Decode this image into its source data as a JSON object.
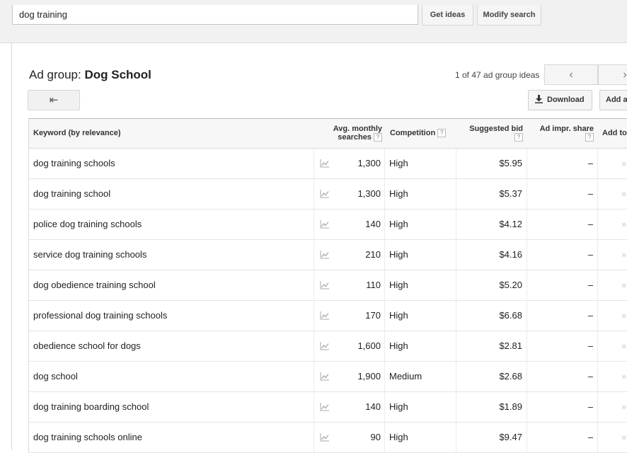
{
  "search": {
    "value": "dog training"
  },
  "buttons": {
    "get_ideas": "Get ideas",
    "modify_search": "Modify search",
    "download": "Download",
    "add": "Add a"
  },
  "adgroup": {
    "prefix": "Ad group:",
    "name": "Dog School",
    "count_text": "1 of 47 ad group ideas"
  },
  "icons": {
    "prev": "chevron-left-icon",
    "next": "chevron-right-icon",
    "back": "back-arrow-icon",
    "download": "download-icon",
    "trend": "trend-chart-icon",
    "add": "double-chevron-icon"
  },
  "table": {
    "headers": {
      "keyword": "Keyword (by relevance)",
      "avg_line1": "Avg. monthly",
      "avg_line2": "searches",
      "competition": "Competition",
      "bid": "Suggested bid",
      "impr": "Ad impr. share",
      "add_to": "Add to"
    },
    "rows": [
      {
        "keyword": "dog training schools",
        "searches": "1,300",
        "competition": "High",
        "bid": "$5.95",
        "impr": "–"
      },
      {
        "keyword": "dog training school",
        "searches": "1,300",
        "competition": "High",
        "bid": "$5.37",
        "impr": "–"
      },
      {
        "keyword": "police dog training schools",
        "searches": "140",
        "competition": "High",
        "bid": "$4.12",
        "impr": "–"
      },
      {
        "keyword": "service dog training schools",
        "searches": "210",
        "competition": "High",
        "bid": "$4.16",
        "impr": "–"
      },
      {
        "keyword": "dog obedience training school",
        "searches": "110",
        "competition": "High",
        "bid": "$5.20",
        "impr": "–"
      },
      {
        "keyword": "professional dog training schools",
        "searches": "170",
        "competition": "High",
        "bid": "$6.68",
        "impr": "–"
      },
      {
        "keyword": "obedience school for dogs",
        "searches": "1,600",
        "competition": "High",
        "bid": "$2.81",
        "impr": "–"
      },
      {
        "keyword": "dog school",
        "searches": "1,900",
        "competition": "Medium",
        "bid": "$2.68",
        "impr": "–"
      },
      {
        "keyword": "dog training boarding school",
        "searches": "140",
        "competition": "High",
        "bid": "$1.89",
        "impr": "–"
      },
      {
        "keyword": "dog training schools online",
        "searches": "90",
        "competition": "High",
        "bid": "$9.47",
        "impr": "–"
      }
    ]
  }
}
